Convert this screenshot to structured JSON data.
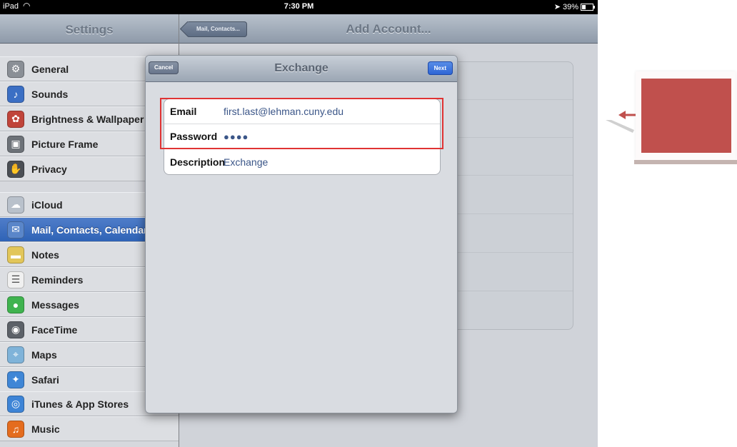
{
  "status_bar": {
    "carrier": "iPad",
    "time": "7:30 PM",
    "battery": "39%",
    "battery_level": 0.39
  },
  "sidebar": {
    "title": "Settings",
    "groups": [
      [
        {
          "label": "General",
          "icon": "gear-icon",
          "color": "#8a8f96"
        },
        {
          "label": "Sounds",
          "icon": "speaker-icon",
          "color": "#3b6fc4"
        },
        {
          "label": "Brightness & Wallpaper",
          "icon": "flower-icon",
          "color": "#c0443a"
        },
        {
          "label": "Picture Frame",
          "icon": "picture-frame-icon",
          "color": "#6d7278"
        },
        {
          "label": "Privacy",
          "icon": "hand-icon",
          "color": "#4b4f55"
        }
      ],
      [
        {
          "label": "iCloud",
          "icon": "cloud-icon",
          "color": "#b9c1cb"
        },
        {
          "label": "Mail, Contacts, Calendars",
          "icon": "mail-icon",
          "color": "#5a86c9",
          "selected": true
        },
        {
          "label": "Notes",
          "icon": "notes-icon",
          "color": "#e2c65a"
        },
        {
          "label": "Reminders",
          "icon": "reminders-icon",
          "color": "#f0f0f0"
        },
        {
          "label": "Messages",
          "icon": "messages-icon",
          "color": "#3fb34f"
        },
        {
          "label": "FaceTime",
          "icon": "camera-icon",
          "color": "#5c6168"
        },
        {
          "label": "Maps",
          "icon": "map-icon",
          "color": "#7fb3d9"
        },
        {
          "label": "Safari",
          "icon": "compass-icon",
          "color": "#3f86d6"
        }
      ],
      [
        {
          "label": "iTunes & App Stores",
          "icon": "app-store-icon",
          "color": "#3d84d6"
        },
        {
          "label": "Music",
          "icon": "music-icon",
          "color": "#e46c1e"
        }
      ]
    ]
  },
  "detail": {
    "back_label": "Mail, Contacts...",
    "title": "Add Account..."
  },
  "modal": {
    "cancel_label": "Cancel",
    "title": "Exchange",
    "next_label": "Next",
    "fields": [
      {
        "label": "Email",
        "value": "first.last@lehman.cuny.edu"
      },
      {
        "label": "Password",
        "value": "●●●●"
      },
      {
        "label": "Description",
        "value": "Exchange"
      }
    ]
  },
  "annotation": {
    "highlight_color": "#e03333",
    "callout_color": "#c0504d"
  }
}
